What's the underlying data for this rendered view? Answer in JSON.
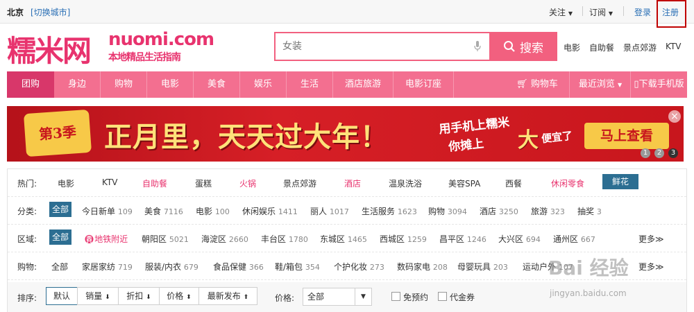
{
  "topbar": {
    "city": "北京",
    "switch_city": "[切换城市]",
    "follow": "关注",
    "subscribe": "订阅",
    "login": "登录",
    "register": "注册"
  },
  "logo": {
    "cn": "糯米网",
    "en": "nuomi.com",
    "sub": "本地精品生活指南"
  },
  "search": {
    "placeholder": "女装",
    "button": "搜索"
  },
  "hot_links": [
    "电影",
    "自助餐",
    "景点郊游",
    "KTV"
  ],
  "nav": {
    "items": [
      "团购",
      "身边",
      "购物",
      "电影",
      "美食",
      "娱乐",
      "生活",
      "酒店旅游",
      "电影订座"
    ],
    "cart": "购物车",
    "recent": "最近浏览",
    "download": "下载手机版"
  },
  "banner": {
    "badge": "第3季",
    "title": "正月里，天天过大年！",
    "line1": "用手机上糯米",
    "line2": "你摊上",
    "big": "大",
    "line3": "便宜了",
    "button": "马上查看",
    "close": "×",
    "pages": [
      "1",
      "2",
      "3"
    ]
  },
  "filter": {
    "hot": {
      "label": "热门:",
      "items": [
        "电影",
        "KTV",
        "自助餐",
        "蛋糕",
        "火锅",
        "景点郊游",
        "酒店",
        "温泉洗浴",
        "美容SPA",
        "西餐",
        "休闲零食",
        "鲜花"
      ]
    },
    "category": {
      "label": "分类:",
      "items": [
        {
          "name": "全部",
          "count": ""
        },
        {
          "name": "今日新单",
          "count": "109"
        },
        {
          "name": "美食",
          "count": "7116"
        },
        {
          "name": "电影",
          "count": "100"
        },
        {
          "name": "休闲娱乐",
          "count": "1411"
        },
        {
          "name": "丽人",
          "count": "1017"
        },
        {
          "name": "生活服务",
          "count": "1623"
        },
        {
          "name": "购物",
          "count": "3094"
        },
        {
          "name": "酒店",
          "count": "3250"
        },
        {
          "name": "旅游",
          "count": "323"
        },
        {
          "name": "抽奖",
          "count": "3"
        }
      ]
    },
    "region": {
      "label": "区域:",
      "items": [
        {
          "name": "全部",
          "count": ""
        },
        {
          "name": "地铁附近",
          "count": ""
        },
        {
          "name": "朝阳区",
          "count": "5021"
        },
        {
          "name": "海淀区",
          "count": "2660"
        },
        {
          "name": "丰台区",
          "count": "1780"
        },
        {
          "name": "东城区",
          "count": "1465"
        },
        {
          "name": "西城区",
          "count": "1259"
        },
        {
          "name": "昌平区",
          "count": "1246"
        },
        {
          "name": "大兴区",
          "count": "694"
        },
        {
          "name": "通州区",
          "count": "667"
        }
      ],
      "more": "更多"
    },
    "shopping": {
      "label": "购物:",
      "items": [
        {
          "name": "全部",
          "count": ""
        },
        {
          "name": "家居家纺",
          "count": "719"
        },
        {
          "name": "服装/内衣",
          "count": "679"
        },
        {
          "name": "食品保健",
          "count": "366"
        },
        {
          "name": "鞋/箱包",
          "count": "354"
        },
        {
          "name": "个护化妆",
          "count": "273"
        },
        {
          "name": "数码家电",
          "count": "208"
        },
        {
          "name": "母婴玩具",
          "count": "203"
        },
        {
          "name": "运动户外",
          "count": "107"
        }
      ],
      "more": "更多"
    },
    "sort": {
      "label": "排序:",
      "buttons": [
        "默认",
        "销量",
        "折扣",
        "价格",
        "最新发布"
      ],
      "price_label": "价格:",
      "price_value": "全部",
      "no_booking": "免预约",
      "voucher": "代金券"
    }
  },
  "watermark": {
    "main": "Bai 经验",
    "url": "jingyan.baidu.com"
  },
  "colors": {
    "brand_pink": "#e8336e",
    "nav_pink": "#f36f90",
    "nav_active": "#d8376a",
    "selected_blue": "#2c6e92",
    "highlight_red": "#c00000"
  }
}
